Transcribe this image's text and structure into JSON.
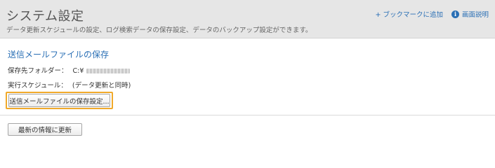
{
  "header": {
    "title": "システム設定",
    "description": "データ更新スケジュールの設定、ログ検索データの保存設定、データのバックアップ設定ができます。",
    "bookmark_link": "+ ブックマークに追加",
    "help_icon": "info-icon",
    "help_link": "画面説明"
  },
  "section": {
    "title": "送信メールファイルの保存",
    "folder_label": "保存先フォルダー：",
    "folder_value": "C:¥",
    "schedule_label": "実行スケジュール：",
    "schedule_value": "(データ更新と同時)",
    "save_button": "送信メールファイルの保存設定..."
  },
  "footer": {
    "refresh_button": "最新の情報に更新"
  },
  "colors": {
    "accent": "#2a6fb5",
    "highlight": "#f0a92a",
    "header_bg": "#e6e6e6"
  }
}
